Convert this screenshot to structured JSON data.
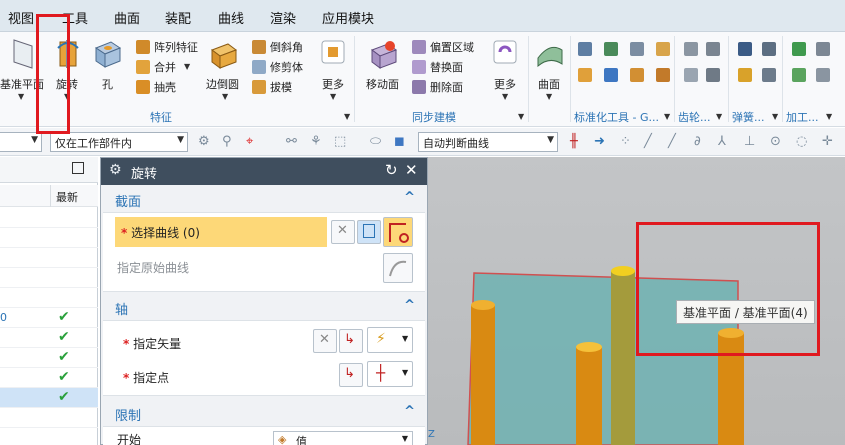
{
  "menu": [
    "视图",
    "工具",
    "曲面",
    "装配",
    "曲线",
    "渲染",
    "应用模块"
  ],
  "ribbon": {
    "datum_plane": "基准平面",
    "revolve": "旋转",
    "hole": "孔",
    "array_feature": "阵列特征",
    "unite": "合并",
    "shell": "抽壳",
    "edge_blend": "边倒圆",
    "chamfer": "倒斜角",
    "trim_body": "修剪体",
    "draft": "拔模",
    "more": "更多",
    "group_feature": "特征",
    "move_face": "移动面",
    "offset_region": "偏置区域",
    "replace_face": "替换面",
    "delete_face": "删除面",
    "more2": "更多",
    "group_sync": "同步建模",
    "surface": "曲面",
    "group_standard": "标准化工具 - G...",
    "group_gear": "齿轮...",
    "group_spring": "弹簧...",
    "group_machining": "加工..."
  },
  "toolbar2": {
    "scope_combo": "仅在工作部件内",
    "curve_rule_combo": "自动判断曲线"
  },
  "navigator": {
    "column_latest": "最新",
    "check_rows": 5,
    "selected_row": 5
  },
  "dialog": {
    "title": "旋转",
    "section_profile": "截面",
    "select_curve": "选择曲线 (0)",
    "specify_origin_curve": "指定原始曲线",
    "section_axis": "轴",
    "specify_vector": "指定矢量",
    "specify_point": "指定点",
    "section_limits": "限制",
    "start_label": "开始",
    "start_value": "值"
  },
  "viewport": {
    "tooltip": "基准平面 / 基准平面(4)",
    "axis_label": "Z"
  },
  "colors": {
    "accent": "#2c74b5",
    "dialog_title_bg": "#3f4e5e",
    "highlight_row": "#fdd878",
    "plane_fill": "#6fb1b1",
    "cylinder": "#d98a12",
    "annotation_red": "#e0191f"
  }
}
